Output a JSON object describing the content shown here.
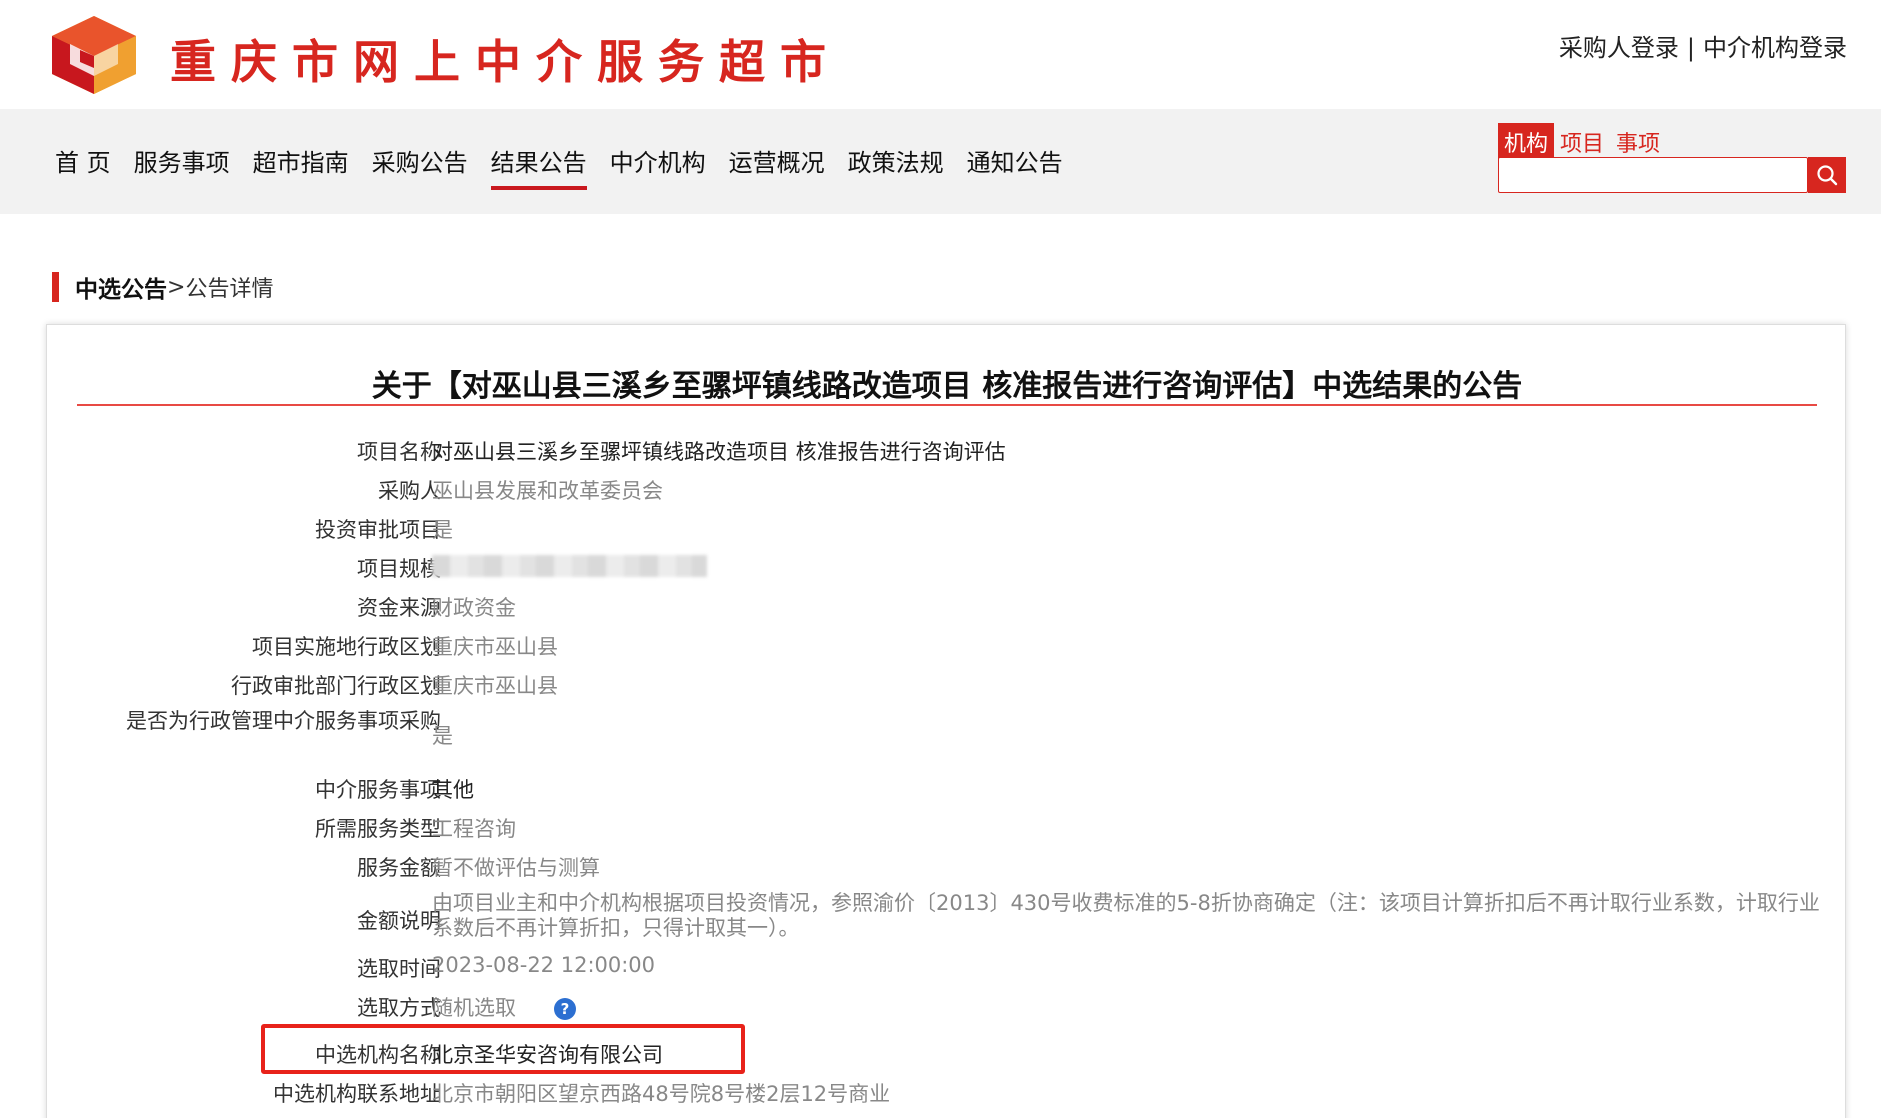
{
  "site": {
    "title": "重庆市网上中介服务超市",
    "buyer_login": "采购人登录",
    "separator": "|",
    "agency_login": "中介机构登录",
    "brand_color": "#d7261f",
    "logo_icon": "cube-logo-icon"
  },
  "nav": {
    "items": [
      {
        "label": "首 页",
        "active": false
      },
      {
        "label": "服务事项",
        "active": false
      },
      {
        "label": "超市指南",
        "active": false
      },
      {
        "label": "采购公告",
        "active": false
      },
      {
        "label": "结果公告",
        "active": true
      },
      {
        "label": "中介机构",
        "active": false
      },
      {
        "label": "运营概况",
        "active": false
      },
      {
        "label": "政策法规",
        "active": false
      },
      {
        "label": "通知公告",
        "active": false
      }
    ]
  },
  "search": {
    "tabs": [
      {
        "label": "机构",
        "active": true
      },
      {
        "label": "项目",
        "active": false
      },
      {
        "label": "事项",
        "active": false
      }
    ],
    "value": "",
    "button_icon": "search-icon"
  },
  "breadcrumb": {
    "main": "中选公告",
    "separator": ">",
    "current": "公告详情"
  },
  "notice": {
    "title": "关于【对巫山县三溪乡至骡坪镇线路改造项目 核准报告进行咨询评估】中选结果的公告",
    "fields": [
      {
        "label": "项目名称",
        "value": "对巫山县三溪乡至骡坪镇线路改造项目 核准报告进行咨询评估"
      },
      {
        "label": "采购人",
        "value": "巫山县发展和改革委员会"
      },
      {
        "label": "投资审批项目",
        "value": "是"
      },
      {
        "label": "项目规模",
        "value": ""
      },
      {
        "label": "资金来源",
        "value": "财政资金"
      },
      {
        "label": "项目实施地行政区划",
        "value": "重庆市巫山县"
      },
      {
        "label": "行政审批部门行政区划",
        "value": "重庆市巫山县"
      },
      {
        "label": "是否为行政管理中介服务事项采购",
        "value": "是"
      },
      {
        "label": "中介服务事项",
        "value": "其他"
      },
      {
        "label": "所需服务类型",
        "value": "工程咨询"
      },
      {
        "label": "服务金额",
        "value": "暂不做评估与测算"
      },
      {
        "label": "金额说明",
        "value": "由项目业主和中介机构根据项目投资情况，参照渝价〔2013〕430号收费标准的5-8折协商确定（注：该项目计算折扣后不再计取行业系数，计取行业系数后不再计算折扣，只得计取其一）。"
      },
      {
        "label": "选取时间",
        "value": "2023-08-22 12:00:00"
      },
      {
        "label": "选取方式",
        "value": "随机选取",
        "help_icon": "question-circle-icon"
      },
      {
        "label": "中选机构名称",
        "value": "北京圣华安咨询有限公司"
      },
      {
        "label": "中选机构联系地址",
        "value": "北京市朝阳区望京西路48号院8号楼2层12号商业"
      }
    ],
    "highlight_color": "#e8221a"
  }
}
